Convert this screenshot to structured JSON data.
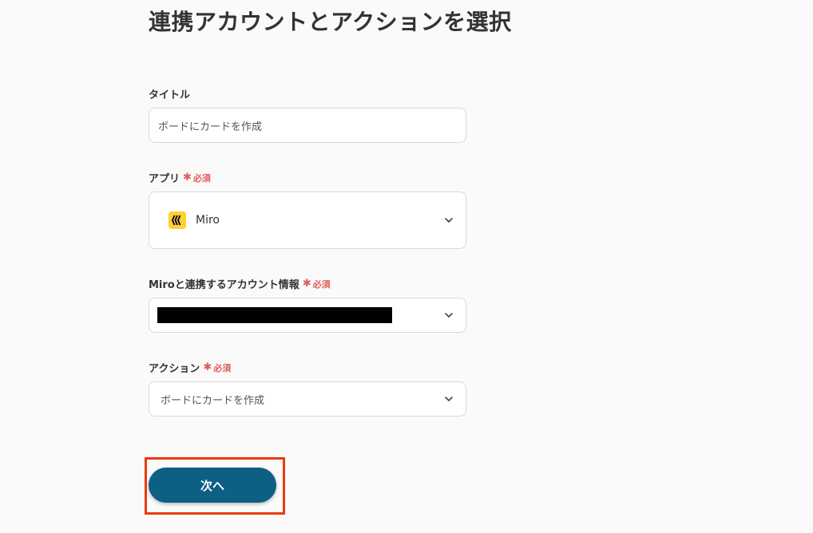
{
  "page": {
    "title": "連携アカウントとアクションを選択"
  },
  "form": {
    "title_field": {
      "label": "タイトル",
      "value": "ボードにカードを作成"
    },
    "app_field": {
      "label": "アプリ",
      "required": "必須",
      "value": "Miro",
      "icon": "miro-logo"
    },
    "account_field": {
      "label": "Miroと連携するアカウント情報",
      "required": "必須",
      "value_redacted": true
    },
    "action_field": {
      "label": "アクション",
      "required": "必須",
      "value": "ボードにカードを作成"
    }
  },
  "actions": {
    "next_label": "次へ"
  },
  "colors": {
    "primary": "#0d5f84",
    "required": "#e05b5b",
    "highlight": "#ea3a0f",
    "miro_yellow": "#ffd02f"
  }
}
